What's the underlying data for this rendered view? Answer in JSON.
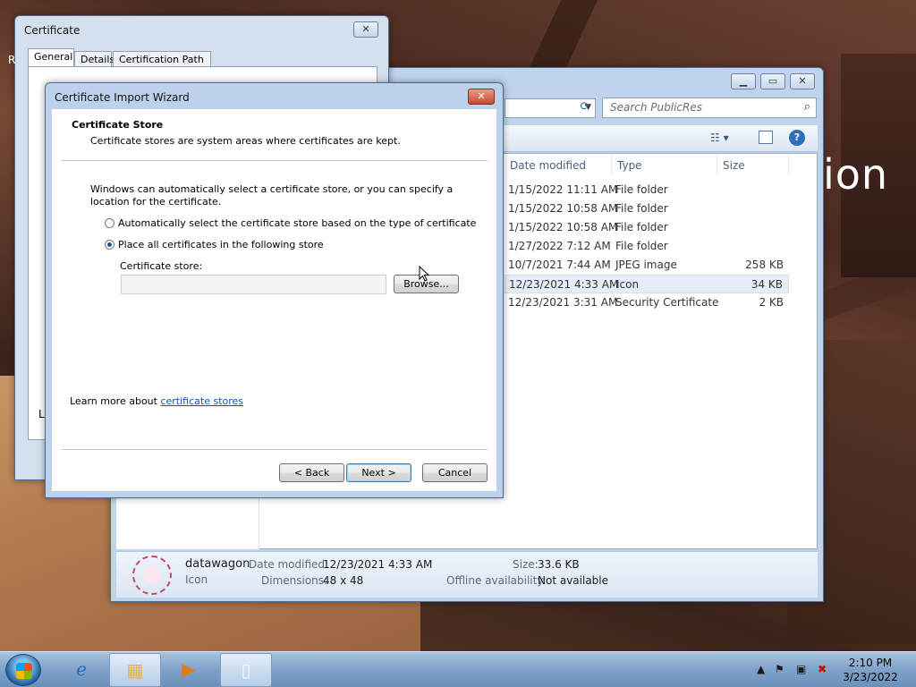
{
  "desktop": {
    "wallpaper_text": "ion"
  },
  "explorer": {
    "search_placeholder": "Search PublicRes",
    "columns": [
      "Date modified",
      "Type",
      "Size"
    ],
    "rows": [
      {
        "date": "1/15/2022 11:11 AM",
        "type": "File folder",
        "size": ""
      },
      {
        "date": "1/15/2022 10:58 AM",
        "type": "File folder",
        "size": ""
      },
      {
        "date": "1/15/2022 10:58 AM",
        "type": "File folder",
        "size": ""
      },
      {
        "date": "1/27/2022 7:12 AM",
        "type": "File folder",
        "size": ""
      },
      {
        "date": "10/7/2021 7:44 AM",
        "type": "JPEG image",
        "size": "258 KB"
      },
      {
        "date": "12/23/2021 4:33 AM",
        "type": "Icon",
        "size": "34 KB"
      },
      {
        "date": "12/23/2021 3:31 AM",
        "type": "Security Certificate",
        "size": "2 KB"
      }
    ],
    "details": {
      "name": "datawagon",
      "kind": "Icon",
      "date_label": "Date modified:",
      "date_value": "12/23/2021 4:33 AM",
      "dim_label": "Dimensions:",
      "dim_value": "48 x 48",
      "size_label": "Size:",
      "size_value": "33.6 KB",
      "offline_label": "Offline availability:",
      "offline_value": "Not available"
    }
  },
  "certificate": {
    "title": "Certificate",
    "tabs": [
      "General",
      "Details",
      "Certification Path"
    ],
    "left_fragment": "Le",
    "r_fragment": "R"
  },
  "wizard": {
    "title": "Certificate Import Wizard",
    "header_title": "Certificate Store",
    "header_sub": "Certificate stores are system areas where certificates are kept.",
    "description": "Windows can automatically select a certificate store, or you can specify a location for the certificate.",
    "option_auto": "Automatically select the certificate store based on the type of certificate",
    "option_place": "Place all certificates in the following store",
    "store_label": "Certificate store:",
    "store_value": "",
    "browse": "Browse...",
    "learn_prefix": "Learn more about ",
    "learn_link": "certificate stores",
    "back": "< Back",
    "next": "Next >",
    "cancel": "Cancel"
  },
  "taskbar": {
    "time": "2:10 PM",
    "date": "3/23/2022"
  }
}
